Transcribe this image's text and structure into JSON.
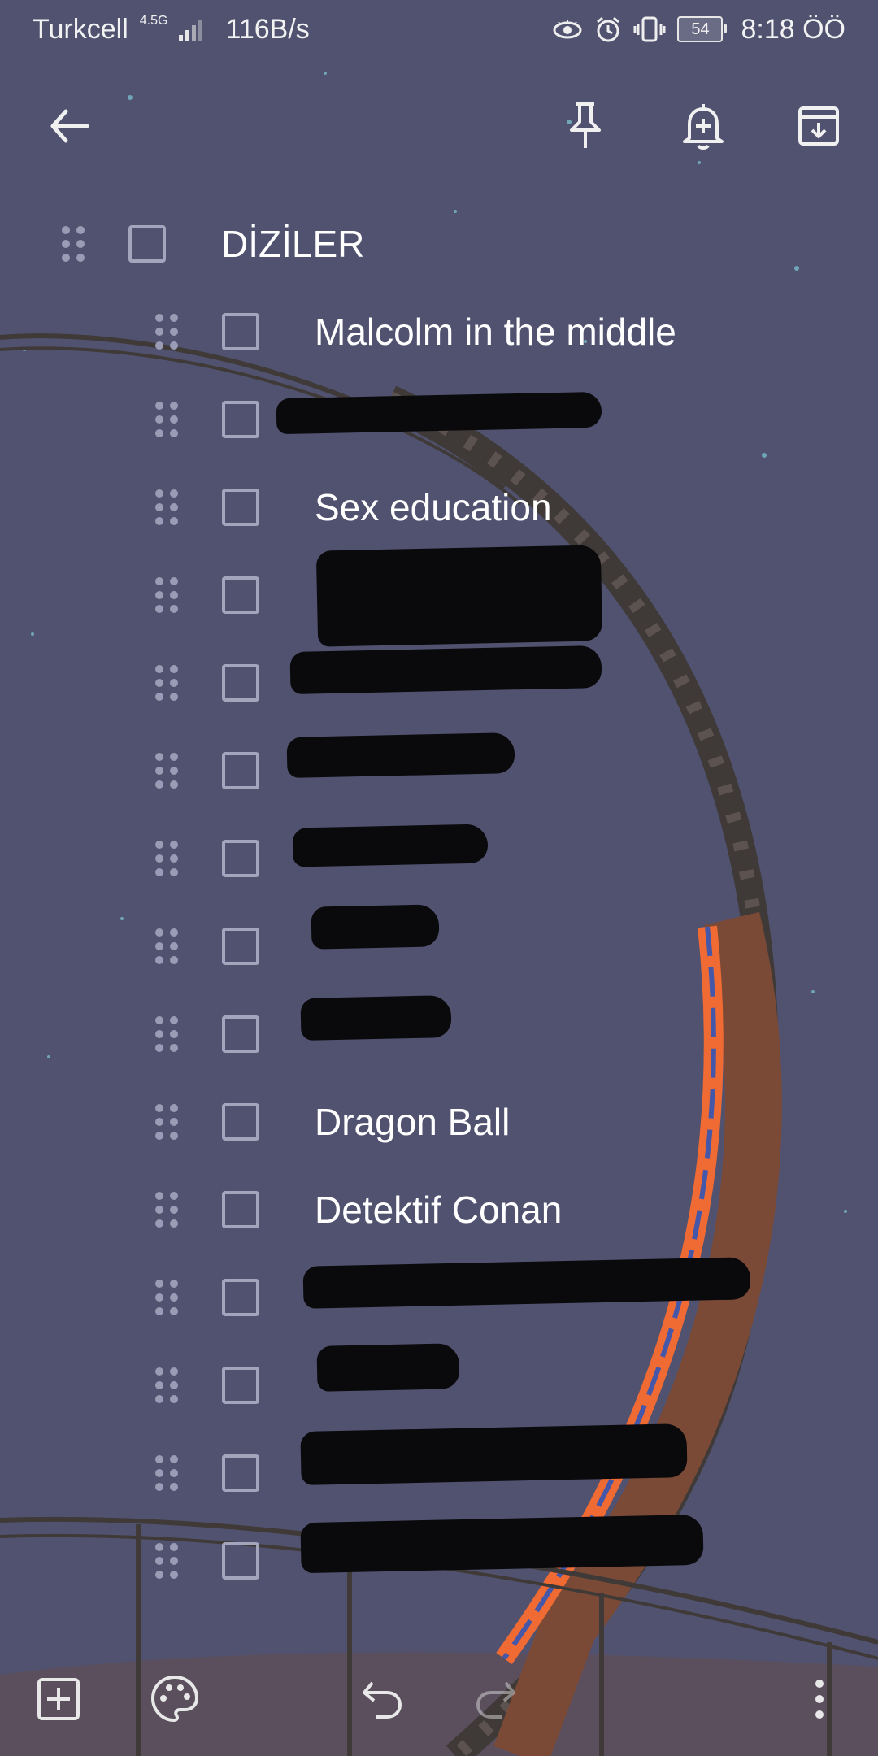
{
  "status_bar": {
    "carrier": "Turkcell",
    "network": "4.5G",
    "speed": "116B/s",
    "battery": "54",
    "time": "8:18 ÖÖ"
  },
  "toolbar": {
    "back_icon": "arrow-left-icon",
    "pin_icon": "pin-icon",
    "reminder_icon": "bell-plus-icon",
    "archive_icon": "archive-icon"
  },
  "note": {
    "title": "DİZİLER",
    "items": [
      {
        "label": "Malcolm in the middle",
        "redacted": false
      },
      {
        "label": "",
        "redacted": true
      },
      {
        "label": "Sex education",
        "redacted": false
      },
      {
        "label": "",
        "redacted": true
      },
      {
        "label": "",
        "redacted": true
      },
      {
        "label": "",
        "redacted": true
      },
      {
        "label": "",
        "redacted": true
      },
      {
        "label": "",
        "redacted": true
      },
      {
        "label": "",
        "redacted": true
      },
      {
        "label": "Dragon Ball",
        "redacted": false
      },
      {
        "label": "Detektif Conan",
        "redacted": false
      },
      {
        "label": "",
        "redacted": true
      },
      {
        "label": "",
        "redacted": true
      },
      {
        "label": "",
        "redacted": true
      },
      {
        "label": "",
        "redacted": true
      }
    ]
  },
  "bottom_bar": {
    "add_icon": "add-box-icon",
    "palette_icon": "palette-icon",
    "undo_icon": "undo-icon",
    "redo_icon": "redo-icon",
    "more_icon": "more-vert-icon"
  },
  "colors": {
    "background": "#505270",
    "track_rail": "#3f3a37",
    "track_wood": "#7a4a37",
    "coaster_orange": "#f06a33",
    "ground": "#5b4f5e"
  }
}
